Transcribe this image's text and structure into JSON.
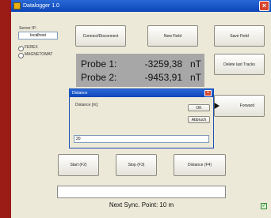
{
  "window": {
    "title": "Datalogger 1.0",
    "close_glyph": "×"
  },
  "server": {
    "label": "Server IP:",
    "value": "localhost"
  },
  "connect_button": "Connect/Disconnect",
  "device_options": [
    {
      "label": "FEREX",
      "selected": true
    },
    {
      "label": "MAGNETOMAT",
      "selected": false
    }
  ],
  "buttons": {
    "new_field": "New Field",
    "save_field": "Save Field",
    "delete_tracks": "Delete last Tracks",
    "forward": "Forward",
    "start": "Start (F2)",
    "stop": "Stop (F3)",
    "distance": "Distance (F4)"
  },
  "probes": [
    {
      "name": "Probe 1:",
      "value": "-3259,38",
      "unit": "nT"
    },
    {
      "name": "Probe 2:",
      "value": "-9453,91",
      "unit": "nT"
    }
  ],
  "dialog": {
    "title": "Distance",
    "close_glyph": "×",
    "prompt": "Distance [m]:",
    "ok_label": "OK",
    "cancel_label": "Abbruch",
    "input_value": "20"
  },
  "status": {
    "field_value": "",
    "text": "Next Sync. Point: 10 m"
  },
  "colors": {
    "titlebar": "#0c45b8",
    "window_bg": "#ece9d8",
    "probe_panel": "#a7a7a7",
    "left_strip": "#9b1b16"
  },
  "icons": {
    "title": "app-icon",
    "forward": "double-arrow-icon",
    "bottom_right": "checkmark-icon"
  }
}
